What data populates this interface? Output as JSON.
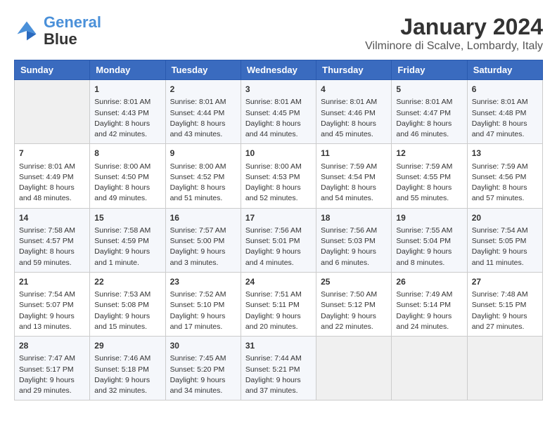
{
  "header": {
    "logo": {
      "line1": "General",
      "line2": "Blue"
    },
    "title": "January 2024",
    "subtitle": "Vilminore di Scalve, Lombardy, Italy"
  },
  "columns": [
    "Sunday",
    "Monday",
    "Tuesday",
    "Wednesday",
    "Thursday",
    "Friday",
    "Saturday"
  ],
  "weeks": [
    [
      {
        "day": "",
        "info": ""
      },
      {
        "day": "1",
        "info": "Sunrise: 8:01 AM\nSunset: 4:43 PM\nDaylight: 8 hours\nand 42 minutes."
      },
      {
        "day": "2",
        "info": "Sunrise: 8:01 AM\nSunset: 4:44 PM\nDaylight: 8 hours\nand 43 minutes."
      },
      {
        "day": "3",
        "info": "Sunrise: 8:01 AM\nSunset: 4:45 PM\nDaylight: 8 hours\nand 44 minutes."
      },
      {
        "day": "4",
        "info": "Sunrise: 8:01 AM\nSunset: 4:46 PM\nDaylight: 8 hours\nand 45 minutes."
      },
      {
        "day": "5",
        "info": "Sunrise: 8:01 AM\nSunset: 4:47 PM\nDaylight: 8 hours\nand 46 minutes."
      },
      {
        "day": "6",
        "info": "Sunrise: 8:01 AM\nSunset: 4:48 PM\nDaylight: 8 hours\nand 47 minutes."
      }
    ],
    [
      {
        "day": "7",
        "info": "Sunrise: 8:01 AM\nSunset: 4:49 PM\nDaylight: 8 hours\nand 48 minutes."
      },
      {
        "day": "8",
        "info": "Sunrise: 8:00 AM\nSunset: 4:50 PM\nDaylight: 8 hours\nand 49 minutes."
      },
      {
        "day": "9",
        "info": "Sunrise: 8:00 AM\nSunset: 4:52 PM\nDaylight: 8 hours\nand 51 minutes."
      },
      {
        "day": "10",
        "info": "Sunrise: 8:00 AM\nSunset: 4:53 PM\nDaylight: 8 hours\nand 52 minutes."
      },
      {
        "day": "11",
        "info": "Sunrise: 7:59 AM\nSunset: 4:54 PM\nDaylight: 8 hours\nand 54 minutes."
      },
      {
        "day": "12",
        "info": "Sunrise: 7:59 AM\nSunset: 4:55 PM\nDaylight: 8 hours\nand 55 minutes."
      },
      {
        "day": "13",
        "info": "Sunrise: 7:59 AM\nSunset: 4:56 PM\nDaylight: 8 hours\nand 57 minutes."
      }
    ],
    [
      {
        "day": "14",
        "info": "Sunrise: 7:58 AM\nSunset: 4:57 PM\nDaylight: 8 hours\nand 59 minutes."
      },
      {
        "day": "15",
        "info": "Sunrise: 7:58 AM\nSunset: 4:59 PM\nDaylight: 9 hours\nand 1 minute."
      },
      {
        "day": "16",
        "info": "Sunrise: 7:57 AM\nSunset: 5:00 PM\nDaylight: 9 hours\nand 3 minutes."
      },
      {
        "day": "17",
        "info": "Sunrise: 7:56 AM\nSunset: 5:01 PM\nDaylight: 9 hours\nand 4 minutes."
      },
      {
        "day": "18",
        "info": "Sunrise: 7:56 AM\nSunset: 5:03 PM\nDaylight: 9 hours\nand 6 minutes."
      },
      {
        "day": "19",
        "info": "Sunrise: 7:55 AM\nSunset: 5:04 PM\nDaylight: 9 hours\nand 8 minutes."
      },
      {
        "day": "20",
        "info": "Sunrise: 7:54 AM\nSunset: 5:05 PM\nDaylight: 9 hours\nand 11 minutes."
      }
    ],
    [
      {
        "day": "21",
        "info": "Sunrise: 7:54 AM\nSunset: 5:07 PM\nDaylight: 9 hours\nand 13 minutes."
      },
      {
        "day": "22",
        "info": "Sunrise: 7:53 AM\nSunset: 5:08 PM\nDaylight: 9 hours\nand 15 minutes."
      },
      {
        "day": "23",
        "info": "Sunrise: 7:52 AM\nSunset: 5:10 PM\nDaylight: 9 hours\nand 17 minutes."
      },
      {
        "day": "24",
        "info": "Sunrise: 7:51 AM\nSunset: 5:11 PM\nDaylight: 9 hours\nand 20 minutes."
      },
      {
        "day": "25",
        "info": "Sunrise: 7:50 AM\nSunset: 5:12 PM\nDaylight: 9 hours\nand 22 minutes."
      },
      {
        "day": "26",
        "info": "Sunrise: 7:49 AM\nSunset: 5:14 PM\nDaylight: 9 hours\nand 24 minutes."
      },
      {
        "day": "27",
        "info": "Sunrise: 7:48 AM\nSunset: 5:15 PM\nDaylight: 9 hours\nand 27 minutes."
      }
    ],
    [
      {
        "day": "28",
        "info": "Sunrise: 7:47 AM\nSunset: 5:17 PM\nDaylight: 9 hours\nand 29 minutes."
      },
      {
        "day": "29",
        "info": "Sunrise: 7:46 AM\nSunset: 5:18 PM\nDaylight: 9 hours\nand 32 minutes."
      },
      {
        "day": "30",
        "info": "Sunrise: 7:45 AM\nSunset: 5:20 PM\nDaylight: 9 hours\nand 34 minutes."
      },
      {
        "day": "31",
        "info": "Sunrise: 7:44 AM\nSunset: 5:21 PM\nDaylight: 9 hours\nand 37 minutes."
      },
      {
        "day": "",
        "info": ""
      },
      {
        "day": "",
        "info": ""
      },
      {
        "day": "",
        "info": ""
      }
    ]
  ]
}
